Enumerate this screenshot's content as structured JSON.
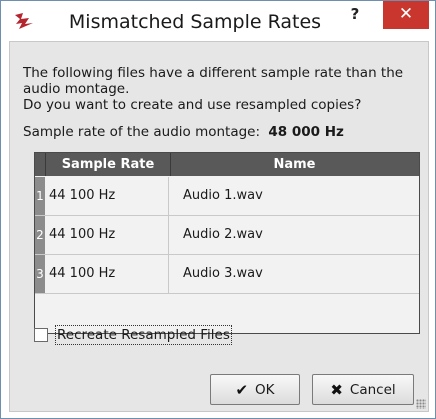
{
  "window": {
    "title": "Mismatched Sample Rates",
    "help_label": "?",
    "close_label": "✕"
  },
  "message": {
    "line1": "The following files have a different sample rate than the audio montage.",
    "line2": "Do you want to create and use resampled copies?"
  },
  "montage_rate": {
    "label": "Sample rate of the audio montage:",
    "value": "48 000 Hz"
  },
  "table": {
    "headers": [
      "Sample Rate",
      "Name"
    ],
    "rows": [
      {
        "num": "1",
        "rate": "44 100 Hz",
        "name": "Audio 1.wav"
      },
      {
        "num": "2",
        "rate": "44 100 Hz",
        "name": "Audio 2.wav"
      },
      {
        "num": "3",
        "rate": "44 100 Hz",
        "name": "Audio 3.wav"
      }
    ]
  },
  "options": {
    "recreate_label": "Recreate Resampled Files",
    "recreate_checked": false
  },
  "buttons": {
    "ok_label": "OK",
    "ok_icon": "checkmark-icon",
    "cancel_label": "Cancel",
    "cancel_icon": "x-icon"
  },
  "colors": {
    "close_button": "#c8362d",
    "table_header": "#595959",
    "row_number": "#8c8c8c",
    "app_icon": "#b3252f"
  }
}
